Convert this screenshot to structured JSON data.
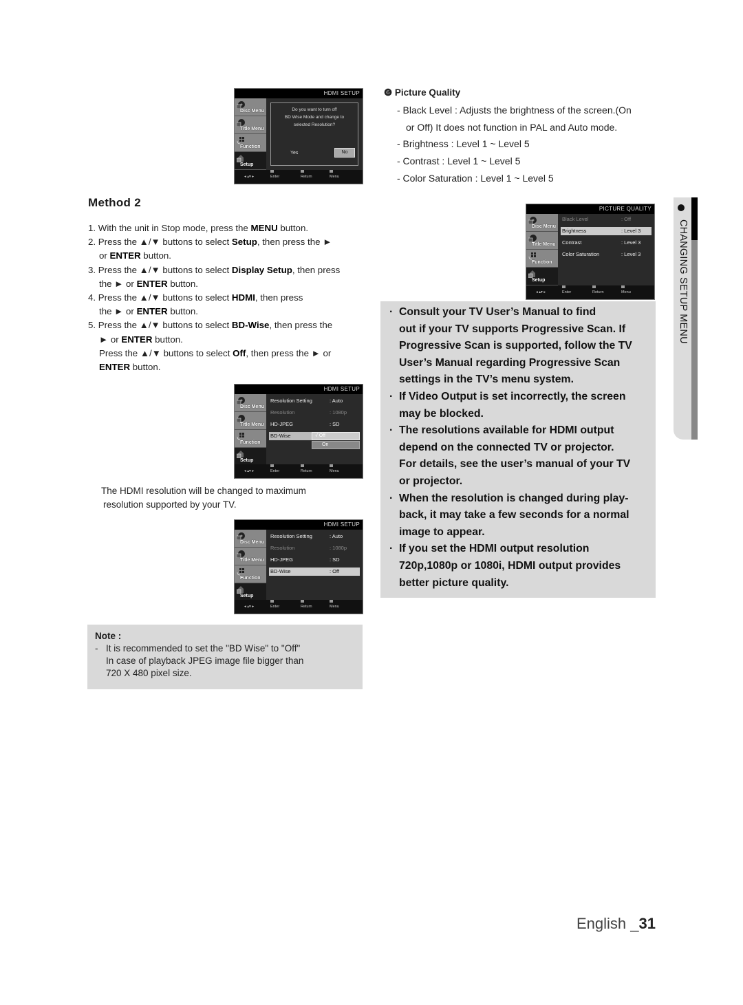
{
  "osd_common": {
    "sidebar": [
      "Disc Menu",
      "Title Menu",
      "Function",
      "Setup"
    ],
    "footer": [
      "Enter",
      "Return",
      "Menu"
    ]
  },
  "screen1": {
    "title": "HDMI SETUP",
    "message_lines": [
      "Do you want to turn off",
      "BD Wise Mode and change to",
      "selected Resolution?"
    ],
    "yes": "Yes",
    "no": "No"
  },
  "picture_quality": {
    "heading_num": "❻",
    "heading": "Picture Quality",
    "items": [
      "- Black Level : Adjusts the brightness of the screen.(On",
      "or Off) It does not function in PAL and Auto mode.",
      "- Brightness : Level 1 ~ Level 5",
      "- Contrast : Level 1 ~ Level 5",
      "- Color Saturation : Level 1 ~ Level 5"
    ]
  },
  "screen_pq": {
    "title": "PICTURE QUALITY",
    "rows": [
      {
        "k": "Black Level",
        "v": ": Off"
      },
      {
        "k": "Brightness",
        "v": ": Level 3"
      },
      {
        "k": "Contrast",
        "v": ": Level 3"
      },
      {
        "k": "Color Saturation",
        "v": ": Level 3"
      }
    ]
  },
  "side_tab": {
    "label": "CHANGING SETUP MENU"
  },
  "method": {
    "title": "Method 2",
    "steps": [
      {
        "n": "1.",
        "parts": [
          "With the unit in Stop mode, press the ",
          "MENU",
          " button."
        ]
      },
      {
        "n": "2.",
        "parts": [
          "Press the ▲/▼ buttons to select ",
          "Setup",
          ", then press the ►"
        ],
        "cont": [
          "or ",
          "ENTER",
          " button."
        ]
      },
      {
        "n": "3.",
        "parts": [
          "Press the ▲/▼ buttons to select ",
          "Display Setup",
          ", then press"
        ],
        "cont": [
          "the ► or ",
          "ENTER",
          " button."
        ]
      },
      {
        "n": "4.",
        "parts": [
          "Press the ▲/▼ buttons to select ",
          "HDMI",
          ", then press"
        ],
        "cont": [
          "the ► or ",
          "ENTER",
          " button."
        ]
      },
      {
        "n": "5.",
        "parts": [
          "Press the ▲/▼ buttons to select ",
          "BD-Wise",
          ", then press the"
        ],
        "cont": [
          "► or ",
          "ENTER",
          " button."
        ]
      }
    ],
    "extra": {
      "parts": [
        "Press the ▲/▼ buttons to select ",
        "Off",
        ", then press the ► or"
      ],
      "cont": [
        "ENTER",
        " button."
      ]
    }
  },
  "screen2": {
    "title": "HDMI SETUP",
    "rows": [
      {
        "k": "Resolution Setting",
        "v": ": Auto"
      },
      {
        "k": "Resolution",
        "v": ": 1080p"
      },
      {
        "k": "HD-JPEG",
        "v": ": SD"
      },
      {
        "k": "BD-Wise",
        "v": ""
      }
    ],
    "dropdown": [
      "√ Off",
      "On"
    ]
  },
  "hdmi_note": [
    "The HDMI resolution will be changed to maximum",
    "resolution supported by your TV."
  ],
  "screen3": {
    "title": "HDMI SETUP",
    "rows": [
      {
        "k": "Resolution Setting",
        "v": ": Auto"
      },
      {
        "k": "Resolution",
        "v": ": 1080p"
      },
      {
        "k": "HD-JPEG",
        "v": ": SD"
      },
      {
        "k": "BD-Wise",
        "v": ": Off"
      }
    ]
  },
  "note": {
    "title": "Note :",
    "dash": "-",
    "lines": [
      "It is recommended to set the \"BD Wise\" to \"Off\"",
      "In case of playback JPEG image file bigger than",
      "720 X 480 pixel size."
    ]
  },
  "tips": [
    [
      "Consult your TV User’s Manual to find",
      "out if your TV supports Progressive Scan. If",
      "Progressive Scan is supported, follow the TV",
      "User’s Manual regarding Progressive Scan",
      "settings in the TV’s menu system."
    ],
    [
      "If Video Output is set incorrectly, the screen",
      "may be blocked."
    ],
    [
      "The resolutions available for HDMI output",
      "depend on the connected TV or projector.",
      "For details, see the user’s manual of your TV",
      "or projector."
    ],
    [
      "When the resolution is changed during play-",
      "back, it may take a few seconds for a normal",
      "image to appear."
    ],
    [
      "If you set the HDMI output resolution",
      "720p,1080p or 1080i, HDMI output provides",
      "better picture quality."
    ]
  ],
  "page_footer": {
    "lang": "English _",
    "page": "31"
  }
}
